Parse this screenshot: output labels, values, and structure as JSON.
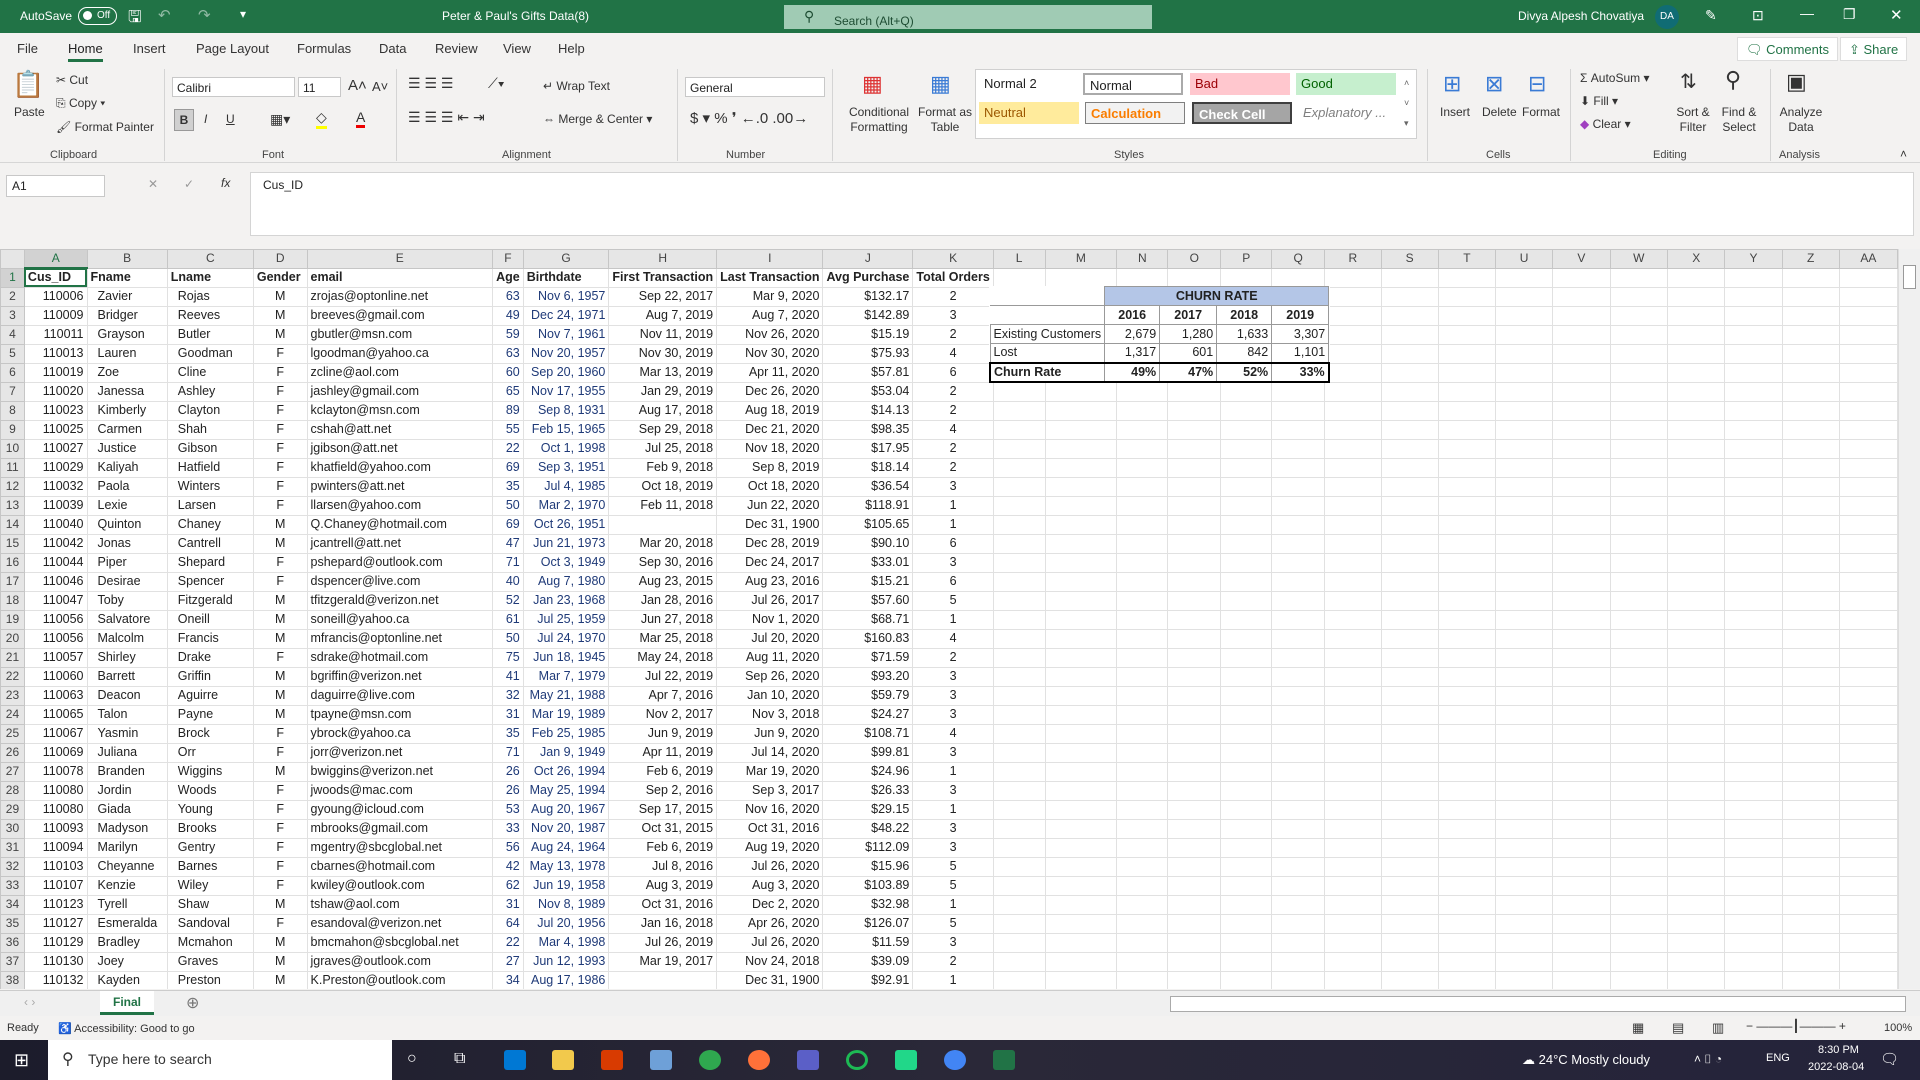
{
  "titlebar": {
    "autosave": "AutoSave",
    "autosave_state": "Off",
    "title": "Peter & Paul's Gifts Data(8)",
    "search_placeholder": "Search (Alt+Q)",
    "user": "Divya Alpesh Chovatiya",
    "initials": "DA"
  },
  "tabs": [
    "File",
    "Home",
    "Insert",
    "Page Layout",
    "Formulas",
    "Data",
    "Review",
    "View",
    "Help"
  ],
  "active_tab": "Home",
  "top_buttons": {
    "comments": "Comments",
    "share": "Share"
  },
  "ribbon": {
    "clipboard": {
      "paste": "Paste",
      "cut": "Cut",
      "copy": "Copy",
      "format_painter": "Format Painter",
      "label": "Clipboard"
    },
    "font": {
      "name": "Calibri",
      "size": "11",
      "label": "Font",
      "bold": "B",
      "italic": "I",
      "underline": "U"
    },
    "alignment": {
      "wrap": "Wrap Text",
      "merge": "Merge & Center",
      "label": "Alignment"
    },
    "number": {
      "format": "General",
      "label": "Number"
    },
    "styles": {
      "conditional": "Conditional Formatting",
      "format_table": "Format as Table",
      "items": [
        "Normal 2",
        "Normal",
        "Bad",
        "Good",
        "Neutral",
        "Calculation",
        "Check Cell",
        "Explanatory ..."
      ],
      "label": "Styles"
    },
    "cells": {
      "insert": "Insert",
      "delete": "Delete",
      "format": "Format",
      "label": "Cells"
    },
    "editing": {
      "autosum": "AutoSum",
      "fill": "Fill",
      "clear": "Clear",
      "sort": "Sort & Filter",
      "find": "Find & Select",
      "label": "Editing"
    },
    "analysis": {
      "analyze": "Analyze Data",
      "label": "Analysis"
    }
  },
  "formula_bar": {
    "name_box": "A1",
    "fx": "fx",
    "content": "Cus_ID"
  },
  "sheet": {
    "columns": [
      "A",
      "B",
      "C",
      "D",
      "E",
      "F",
      "G",
      "H",
      "I",
      "J",
      "K",
      "L",
      "M",
      "N",
      "O",
      "P",
      "Q",
      "R",
      "S",
      "T",
      "U",
      "V",
      "W",
      "X",
      "Y",
      "Z",
      "AA"
    ],
    "headers": [
      "Cus_ID",
      "Fname",
      "Lname",
      "Gender",
      "email",
      "Age",
      "Birthdate",
      "First Transaction",
      "Last Transaction",
      "Avg Purchase",
      "Total Orders"
    ],
    "rows": [
      [
        "110006",
        "Zavier",
        "Rojas",
        "M",
        "zrojas@optonline.net",
        "63",
        "Nov 6, 1957",
        "Sep 22, 2017",
        "Mar 9, 2020",
        "$132.17",
        "2"
      ],
      [
        "110009",
        "Bridger",
        "Reeves",
        "M",
        "breeves@gmail.com",
        "49",
        "Dec 24, 1971",
        "Aug 7, 2019",
        "Aug 7, 2020",
        "$142.89",
        "3"
      ],
      [
        "110011",
        "Grayson",
        "Butler",
        "M",
        "gbutler@msn.com",
        "59",
        "Nov 7, 1961",
        "Nov 11, 2019",
        "Nov 26, 2020",
        "$15.19",
        "2"
      ],
      [
        "110013",
        "Lauren",
        "Goodman",
        "F",
        "lgoodman@yahoo.ca",
        "63",
        "Nov 20, 1957",
        "Nov 30, 2019",
        "Nov 30, 2020",
        "$75.93",
        "4"
      ],
      [
        "110019",
        "Zoe",
        "Cline",
        "F",
        "zcline@aol.com",
        "60",
        "Sep 20, 1960",
        "Mar 13, 2019",
        "Apr 11, 2020",
        "$57.81",
        "6"
      ],
      [
        "110020",
        "Janessa",
        "Ashley",
        "F",
        "jashley@gmail.com",
        "65",
        "Nov 17, 1955",
        "Jan 29, 2019",
        "Dec 26, 2020",
        "$53.04",
        "2"
      ],
      [
        "110023",
        "Kimberly",
        "Clayton",
        "F",
        "kclayton@msn.com",
        "89",
        "Sep 8, 1931",
        "Aug 17, 2018",
        "Aug 18, 2019",
        "$14.13",
        "2"
      ],
      [
        "110025",
        "Carmen",
        "Shah",
        "F",
        "cshah@att.net",
        "55",
        "Feb 15, 1965",
        "Sep 29, 2018",
        "Dec 21, 2020",
        "$98.35",
        "4"
      ],
      [
        "110027",
        "Justice",
        "Gibson",
        "F",
        "jgibson@att.net",
        "22",
        "Oct 1, 1998",
        "Jul 25, 2018",
        "Nov 18, 2020",
        "$17.95",
        "2"
      ],
      [
        "110029",
        "Kaliyah",
        "Hatfield",
        "F",
        "khatfield@yahoo.com",
        "69",
        "Sep 3, 1951",
        "Feb 9, 2018",
        "Sep 8, 2019",
        "$18.14",
        "2"
      ],
      [
        "110032",
        "Paola",
        "Winters",
        "F",
        "pwinters@att.net",
        "35",
        "Jul 4, 1985",
        "Oct 18, 2019",
        "Oct 18, 2020",
        "$36.54",
        "3"
      ],
      [
        "110039",
        "Lexie",
        "Larsen",
        "F",
        "llarsen@yahoo.com",
        "50",
        "Mar 2, 1970",
        "Feb 11, 2018",
        "Jun 22, 2020",
        "$118.91",
        "1"
      ],
      [
        "110040",
        "Quinton",
        "Chaney",
        "M",
        "Q.Chaney@hotmail.com",
        "69",
        "Oct 26, 1951",
        "",
        "Dec 31, 1900",
        "$105.65",
        "1"
      ],
      [
        "110042",
        "Jonas",
        "Cantrell",
        "M",
        "jcantrell@att.net",
        "47",
        "Jun 21, 1973",
        "Mar 20, 2018",
        "Dec 28, 2019",
        "$90.10",
        "6"
      ],
      [
        "110044",
        "Piper",
        "Shepard",
        "F",
        "pshepard@outlook.com",
        "71",
        "Oct 3, 1949",
        "Sep 30, 2016",
        "Dec 24, 2017",
        "$33.01",
        "3"
      ],
      [
        "110046",
        "Desirae",
        "Spencer",
        "F",
        "dspencer@live.com",
        "40",
        "Aug 7, 1980",
        "Aug 23, 2015",
        "Aug 23, 2016",
        "$15.21",
        "6"
      ],
      [
        "110047",
        "Toby",
        "Fitzgerald",
        "M",
        "tfitzgerald@verizon.net",
        "52",
        "Jan 23, 1968",
        "Jan 28, 2016",
        "Jul 26, 2017",
        "$57.60",
        "5"
      ],
      [
        "110056",
        "Salvatore",
        "Oneill",
        "M",
        "soneill@yahoo.ca",
        "61",
        "Jul 25, 1959",
        "Jun 27, 2018",
        "Nov 1, 2020",
        "$68.71",
        "1"
      ],
      [
        "110056",
        "Malcolm",
        "Francis",
        "M",
        "mfrancis@optonline.net",
        "50",
        "Jul 24, 1970",
        "Mar 25, 2018",
        "Jul 20, 2020",
        "$160.83",
        "4"
      ],
      [
        "110057",
        "Shirley",
        "Drake",
        "F",
        "sdrake@hotmail.com",
        "75",
        "Jun 18, 1945",
        "May 24, 2018",
        "Aug 11, 2020",
        "$71.59",
        "2"
      ],
      [
        "110060",
        "Barrett",
        "Griffin",
        "M",
        "bgriffin@verizon.net",
        "41",
        "Mar 7, 1979",
        "Jul 22, 2019",
        "Sep 26, 2020",
        "$93.20",
        "3"
      ],
      [
        "110063",
        "Deacon",
        "Aguirre",
        "M",
        "daguirre@live.com",
        "32",
        "May 21, 1988",
        "Apr 7, 2016",
        "Jan 10, 2020",
        "$59.79",
        "3"
      ],
      [
        "110065",
        "Talon",
        "Payne",
        "M",
        "tpayne@msn.com",
        "31",
        "Mar 19, 1989",
        "Nov 2, 2017",
        "Nov 3, 2018",
        "$24.27",
        "3"
      ],
      [
        "110067",
        "Yasmin",
        "Brock",
        "F",
        "ybrock@yahoo.ca",
        "35",
        "Feb 25, 1985",
        "Jun 9, 2019",
        "Jun 9, 2020",
        "$108.71",
        "4"
      ],
      [
        "110069",
        "Juliana",
        "Orr",
        "F",
        "jorr@verizon.net",
        "71",
        "Jan 9, 1949",
        "Apr 11, 2019",
        "Jul 14, 2020",
        "$99.81",
        "3"
      ],
      [
        "110078",
        "Branden",
        "Wiggins",
        "M",
        "bwiggins@verizon.net",
        "26",
        "Oct 26, 1994",
        "Feb 6, 2019",
        "Mar 19, 2020",
        "$24.96",
        "1"
      ],
      [
        "110080",
        "Jordin",
        "Woods",
        "F",
        "jwoods@mac.com",
        "26",
        "May 25, 1994",
        "Sep 2, 2016",
        "Sep 3, 2017",
        "$26.33",
        "3"
      ],
      [
        "110080",
        "Giada",
        "Young",
        "F",
        "gyoung@icloud.com",
        "53",
        "Aug 20, 1967",
        "Sep 17, 2015",
        "Nov 16, 2020",
        "$29.15",
        "1"
      ],
      [
        "110093",
        "Madyson",
        "Brooks",
        "F",
        "mbrooks@gmail.com",
        "33",
        "Nov 20, 1987",
        "Oct 31, 2015",
        "Oct 31, 2016",
        "$48.22",
        "3"
      ],
      [
        "110094",
        "Marilyn",
        "Gentry",
        "F",
        "mgentry@sbcglobal.net",
        "56",
        "Aug 24, 1964",
        "Feb 6, 2019",
        "Aug 19, 2020",
        "$112.09",
        "3"
      ],
      [
        "110103",
        "Cheyanne",
        "Barnes",
        "F",
        "cbarnes@hotmail.com",
        "42",
        "May 13, 1978",
        "Jul 8, 2016",
        "Jul 26, 2020",
        "$15.96",
        "5"
      ],
      [
        "110107",
        "Kenzie",
        "Wiley",
        "F",
        "kwiley@outlook.com",
        "62",
        "Jun 19, 1958",
        "Aug 3, 2019",
        "Aug 3, 2020",
        "$103.89",
        "5"
      ],
      [
        "110123",
        "Tyrell",
        "Shaw",
        "M",
        "tshaw@aol.com",
        "31",
        "Nov 8, 1989",
        "Oct 31, 2016",
        "Dec 2, 2020",
        "$32.98",
        "1"
      ],
      [
        "110127",
        "Esmeralda",
        "Sandoval",
        "F",
        "esandoval@verizon.net",
        "64",
        "Jul 20, 1956",
        "Jan 16, 2018",
        "Apr 26, 2020",
        "$126.07",
        "5"
      ],
      [
        "110129",
        "Bradley",
        "Mcmahon",
        "M",
        "bmcmahon@sbcglobal.net",
        "22",
        "Mar 4, 1998",
        "Jul 26, 2019",
        "Jul 26, 2020",
        "$11.59",
        "3"
      ],
      [
        "110130",
        "Joey",
        "Graves",
        "M",
        "jgraves@outlook.com",
        "27",
        "Jun 12, 1993",
        "Mar 19, 2017",
        "Nov 24, 2018",
        "$39.09",
        "2"
      ],
      [
        "110132",
        "Kayden",
        "Preston",
        "M",
        "K.Preston@outlook.com",
        "34",
        "Aug 17, 1986",
        "",
        "Dec 31, 1900",
        "$92.91",
        "1"
      ]
    ]
  },
  "churn": {
    "title": "CHURN RATE",
    "years": [
      "2016",
      "2017",
      "2018",
      "2019"
    ],
    "rows": [
      {
        "label": "Existing Customers",
        "values": [
          "2,679",
          "1,280",
          "1,633",
          "3,307"
        ]
      },
      {
        "label": "Lost",
        "values": [
          "1,317",
          "601",
          "842",
          "1,101"
        ]
      },
      {
        "label": "Churn Rate",
        "values": [
          "49%",
          "47%",
          "52%",
          "33%"
        ]
      }
    ],
    "header_color": "#b4c6e7"
  },
  "sheet_tabs": [
    "Final"
  ],
  "status": {
    "ready": "Ready",
    "accessibility": "Accessibility: Good to go",
    "zoom": "100%"
  },
  "taskbar": {
    "search_placeholder": "Type here to search",
    "weather": "24°C  Mostly cloudy",
    "lang": "ENG",
    "time": "8:30 PM",
    "date": "2022-08-04"
  },
  "colors": {
    "excel_green": "#217346"
  }
}
